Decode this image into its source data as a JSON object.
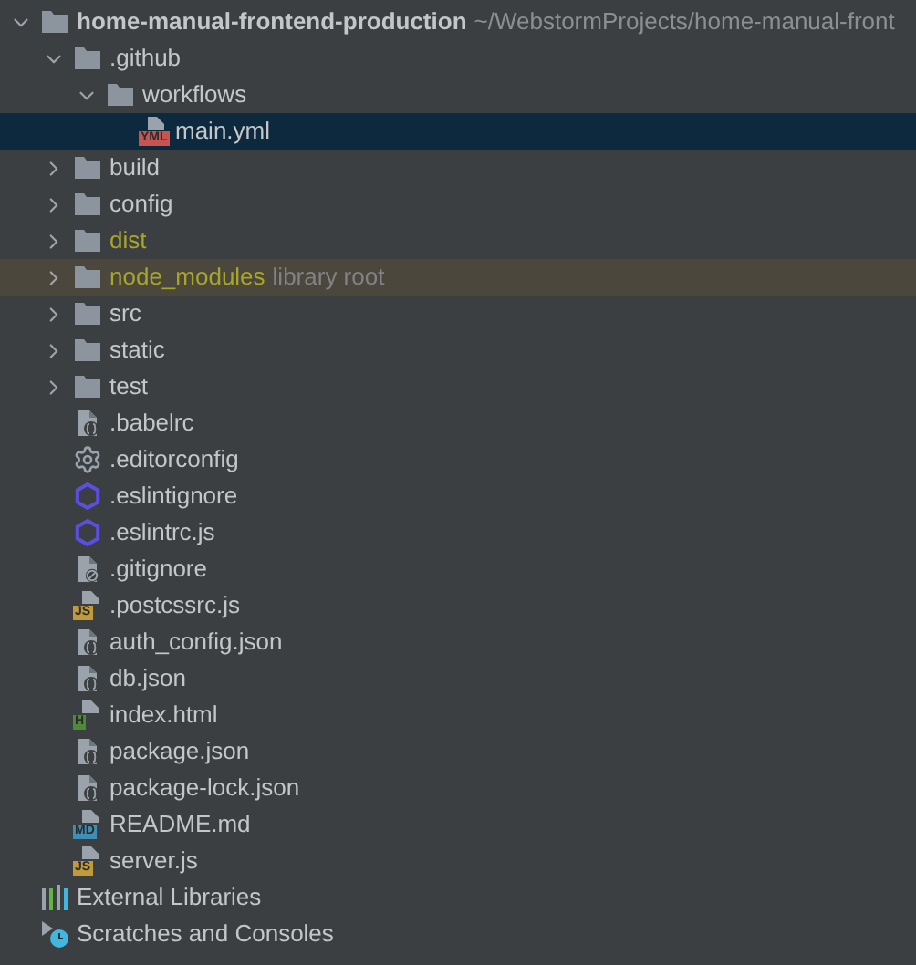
{
  "project": {
    "name": "home-manual-frontend-production",
    "path": "~/WebstormProjects/home-manual-front",
    "expanded": true,
    "selected": false,
    "children": [
      {
        "name": ".github",
        "kind": "folder",
        "expanded": true,
        "selected": false,
        "excluded": false,
        "highlighted": false,
        "children": [
          {
            "name": "workflows",
            "kind": "folder",
            "expanded": true,
            "selected": false,
            "excluded": false,
            "highlighted": false,
            "children": [
              {
                "name": "main.yml",
                "kind": "badge_file",
                "badge": "YML",
                "color": "#c75450",
                "selected": true,
                "excluded": false,
                "highlighted": false
              }
            ]
          }
        ]
      },
      {
        "name": "build",
        "kind": "folder",
        "expanded": false,
        "selected": false,
        "excluded": false,
        "highlighted": false
      },
      {
        "name": "config",
        "kind": "folder",
        "expanded": false,
        "selected": false,
        "excluded": false,
        "highlighted": false
      },
      {
        "name": "dist",
        "kind": "folder",
        "expanded": false,
        "selected": false,
        "excluded": true,
        "highlighted": false
      },
      {
        "name": "node_modules",
        "kind": "folder",
        "expanded": false,
        "selected": false,
        "excluded": true,
        "highlighted": true,
        "note": "library root"
      },
      {
        "name": "src",
        "kind": "folder",
        "expanded": false,
        "selected": false,
        "excluded": false,
        "highlighted": false
      },
      {
        "name": "static",
        "kind": "folder",
        "expanded": false,
        "selected": false,
        "excluded": false,
        "highlighted": false
      },
      {
        "name": "test",
        "kind": "folder",
        "expanded": false,
        "selected": false,
        "excluded": false,
        "highlighted": false
      },
      {
        "name": ".babelrc",
        "kind": "json_file",
        "selected": false,
        "excluded": false,
        "highlighted": false
      },
      {
        "name": ".editorconfig",
        "kind": "settings_file",
        "selected": false,
        "excluded": false,
        "highlighted": false
      },
      {
        "name": ".eslintignore",
        "kind": "eslint_file",
        "selected": false,
        "excluded": false,
        "highlighted": false
      },
      {
        "name": ".eslintrc.js",
        "kind": "eslint_file",
        "selected": false,
        "excluded": false,
        "highlighted": false
      },
      {
        "name": ".gitignore",
        "kind": "ignore_file",
        "selected": false,
        "excluded": false,
        "highlighted": false
      },
      {
        "name": ".postcssrc.js",
        "kind": "badge_file",
        "badge": "JS",
        "color": "#c19a3a",
        "selected": false,
        "excluded": false,
        "highlighted": false
      },
      {
        "name": "auth_config.json",
        "kind": "json_file",
        "selected": false,
        "excluded": false,
        "highlighted": false
      },
      {
        "name": "db.json",
        "kind": "json_file",
        "selected": false,
        "excluded": false,
        "highlighted": false
      },
      {
        "name": "index.html",
        "kind": "badge_file",
        "badge": "H",
        "color": "#4f8a3a",
        "selected": false,
        "excluded": false,
        "highlighted": false
      },
      {
        "name": "package.json",
        "kind": "json_file",
        "selected": false,
        "excluded": false,
        "highlighted": false
      },
      {
        "name": "package-lock.json",
        "kind": "json_file",
        "selected": false,
        "excluded": false,
        "highlighted": false
      },
      {
        "name": "README.md",
        "kind": "badge_file",
        "badge": "MD",
        "color": "#3f8fb5",
        "selected": false,
        "excluded": false,
        "highlighted": false
      },
      {
        "name": "server.js",
        "kind": "badge_file",
        "badge": "JS",
        "color": "#c19a3a",
        "selected": false,
        "excluded": false,
        "highlighted": false
      }
    ]
  },
  "extras": [
    {
      "name": "External Libraries",
      "kind": "libraries",
      "selected": false
    },
    {
      "name": "Scratches and Consoles",
      "kind": "scratches",
      "selected": false
    }
  ]
}
